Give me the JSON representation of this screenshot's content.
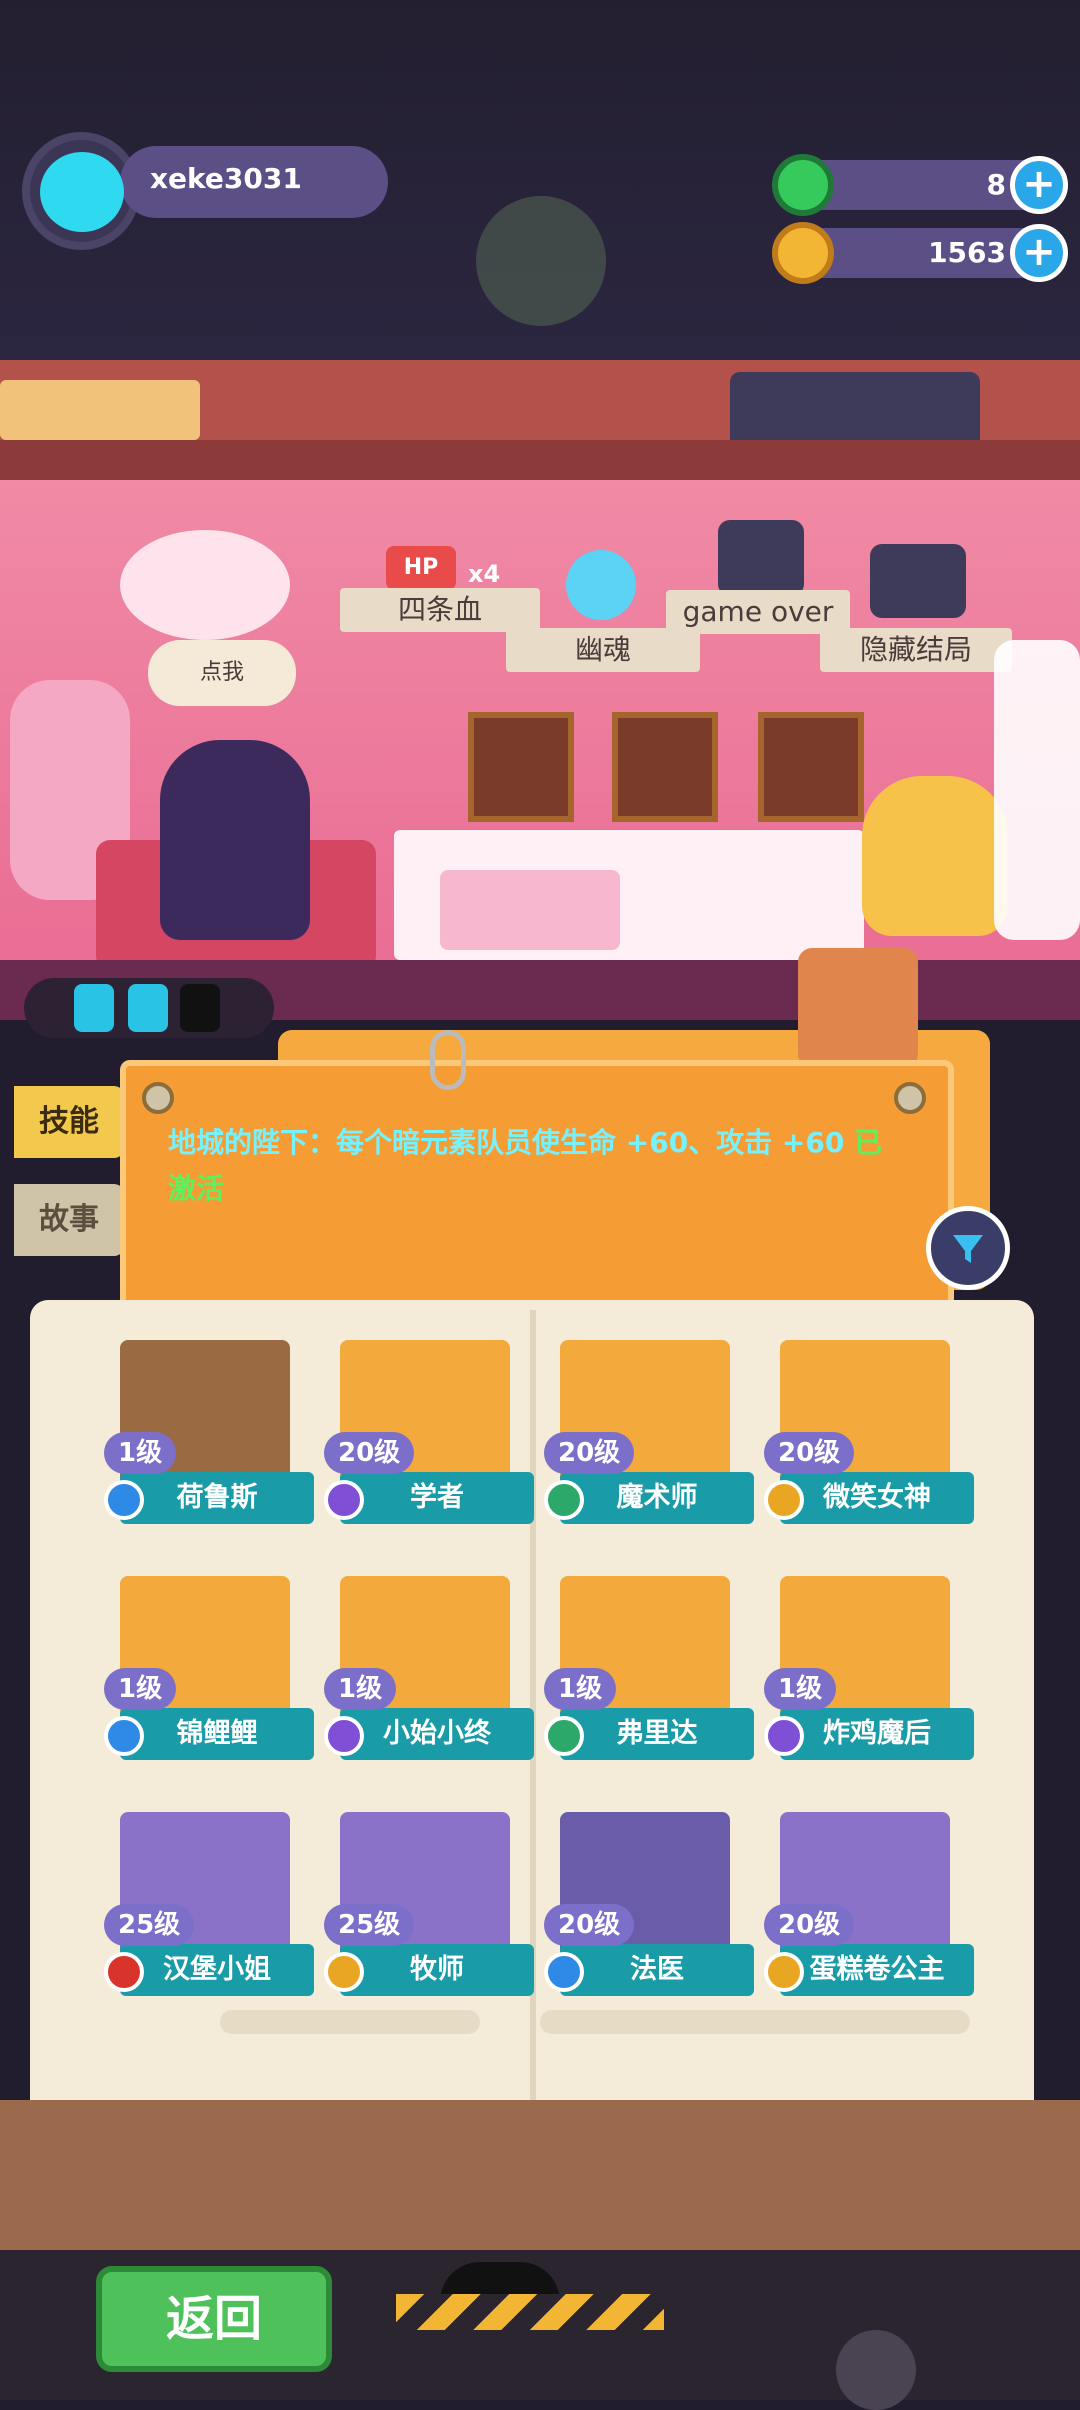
{
  "user": {
    "name": "xeke3031"
  },
  "resources": [
    {
      "name": "gem",
      "icon": "green-gem-icon",
      "value": "8",
      "color": "#36c95b"
    },
    {
      "name": "coin",
      "icon": "gold-coin-icon",
      "value": "1563",
      "color": "#f2b634"
    }
  ],
  "shop": {
    "banners": [
      "四条血",
      "幽魂",
      "game over",
      "隐藏结局"
    ],
    "hp_multiplier": "x4",
    "hp_label": "HP",
    "speech": "点我"
  },
  "sidetabs": {
    "skill": "技能",
    "story": "故事"
  },
  "skill": {
    "text": "地城的陛下：每个暗元素队员使生命 +60、攻击 +60 ",
    "status": "已激活"
  },
  "cards": [
    {
      "name": "荷鲁斯",
      "level": "1级",
      "element": "blue",
      "bg": "#9a6a42"
    },
    {
      "name": "学者",
      "level": "20级",
      "element": "purple",
      "bg": "#f3a93c"
    },
    {
      "name": "魔术师",
      "level": "20级",
      "element": "green",
      "bg": "#f3a93c"
    },
    {
      "name": "微笑女神",
      "level": "20级",
      "element": "gold",
      "bg": "#f3a93c"
    },
    {
      "name": "锦鲤鲤",
      "level": "1级",
      "element": "blue",
      "bg": "#f3a93c"
    },
    {
      "name": "小始小终",
      "level": "1级",
      "element": "purple",
      "bg": "#f3a93c"
    },
    {
      "name": "弗里达",
      "level": "1级",
      "element": "green",
      "bg": "#f3a93c"
    },
    {
      "name": "炸鸡魔后",
      "level": "1级",
      "element": "purple",
      "bg": "#f3a93c"
    },
    {
      "name": "汉堡小姐",
      "level": "25级",
      "element": "red",
      "bg": "#8b72c9"
    },
    {
      "name": "牧师",
      "level": "25级",
      "element": "gold",
      "bg": "#8b72c9"
    },
    {
      "name": "法医",
      "level": "20级",
      "element": "blue",
      "bg": "#6a5ca8"
    },
    {
      "name": "蛋糕卷公主",
      "level": "20级",
      "element": "gold",
      "bg": "#8b72c9"
    }
  ],
  "element_colors": {
    "blue": "#2e8ae6",
    "purple": "#7f4fd6",
    "green": "#2ca86b",
    "gold": "#e8a623",
    "red": "#d9342b"
  },
  "bottom": {
    "back_label": "返回"
  }
}
